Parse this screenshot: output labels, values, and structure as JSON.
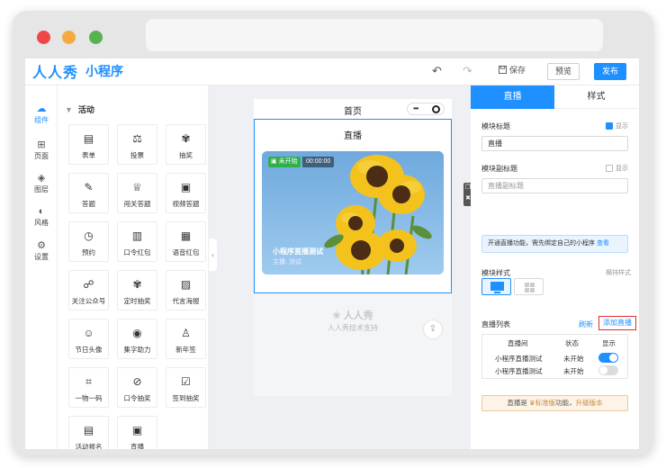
{
  "app": {
    "logo": "人人秀",
    "subtitle": "小程序"
  },
  "toolbar": {
    "save": "保存",
    "preview": "预览",
    "publish": "发布"
  },
  "rail": [
    {
      "label": "组件",
      "icon": "component-icon"
    },
    {
      "label": "页面",
      "icon": "page-icon"
    },
    {
      "label": "图层",
      "icon": "layer-icon"
    },
    {
      "label": "风格",
      "icon": "palette-icon"
    },
    {
      "label": "设置",
      "icon": "settings-icon"
    }
  ],
  "panel": {
    "section": "活动",
    "components": [
      {
        "label": "表单",
        "glyph": "▤"
      },
      {
        "label": "投票",
        "glyph": "⚖"
      },
      {
        "label": "抽奖",
        "glyph": "✾"
      },
      {
        "label": "答题",
        "glyph": "✎"
      },
      {
        "label": "闯关答题",
        "glyph": "♕"
      },
      {
        "label": "视频答题",
        "glyph": "▣"
      },
      {
        "label": "预约",
        "glyph": "◷"
      },
      {
        "label": "口令红包",
        "glyph": "▥"
      },
      {
        "label": "语音红包",
        "glyph": "▦"
      },
      {
        "label": "关注公众号",
        "glyph": "☍"
      },
      {
        "label": "定时抽奖",
        "glyph": "✾"
      },
      {
        "label": "代言海报",
        "glyph": "▨"
      },
      {
        "label": "节日头像",
        "glyph": "☺"
      },
      {
        "label": "集字助力",
        "glyph": "◉"
      },
      {
        "label": "新年签",
        "glyph": "♙"
      },
      {
        "label": "一物一码",
        "glyph": "⌗"
      },
      {
        "label": "口令抽奖",
        "glyph": "⊘"
      },
      {
        "label": "签到抽奖",
        "glyph": "☑"
      },
      {
        "label": "活动报名",
        "glyph": "▤"
      },
      {
        "label": "直播",
        "glyph": "▣"
      }
    ]
  },
  "phone": {
    "title": "首页",
    "capsule_more": "•••",
    "module_title": "直播",
    "live": {
      "status": "未开始",
      "time": "00:00:00",
      "name": "小程序直播测试",
      "host": "主播: 测试"
    },
    "footer_logo": "人人秀",
    "footer_text": "人人秀技术支持"
  },
  "settings": {
    "tabs": [
      "直播",
      "样式"
    ],
    "module_title_label": "模块标题",
    "show_label": "显示",
    "module_title_value": "直播",
    "module_subtitle_label": "模块副标题",
    "module_subtitle_placeholder": "直播副标题",
    "notice_text": "开通直播功能，需先绑定自己的小程序 ",
    "notice_link": "查看",
    "style_label": "模块样式",
    "style_hint": "横排样式",
    "list_label": "直播列表",
    "refresh": "刷新",
    "add_live": "添加直播",
    "table_headers": [
      "直播间",
      "状态",
      "显示"
    ],
    "table_rows": [
      {
        "name": "小程序直播测试",
        "status": "未开始",
        "show": true
      },
      {
        "name": "小程序直播测试",
        "status": "未开始",
        "show": false
      }
    ],
    "upgrade_prefix": "直播是",
    "upgrade_badge": "标准版",
    "upgrade_middle": "功能，",
    "upgrade_link": "升级版本"
  },
  "colors": {
    "brand": "#1e90ff",
    "live_status": "#2fb04a",
    "highlight": "#e52a2a"
  }
}
